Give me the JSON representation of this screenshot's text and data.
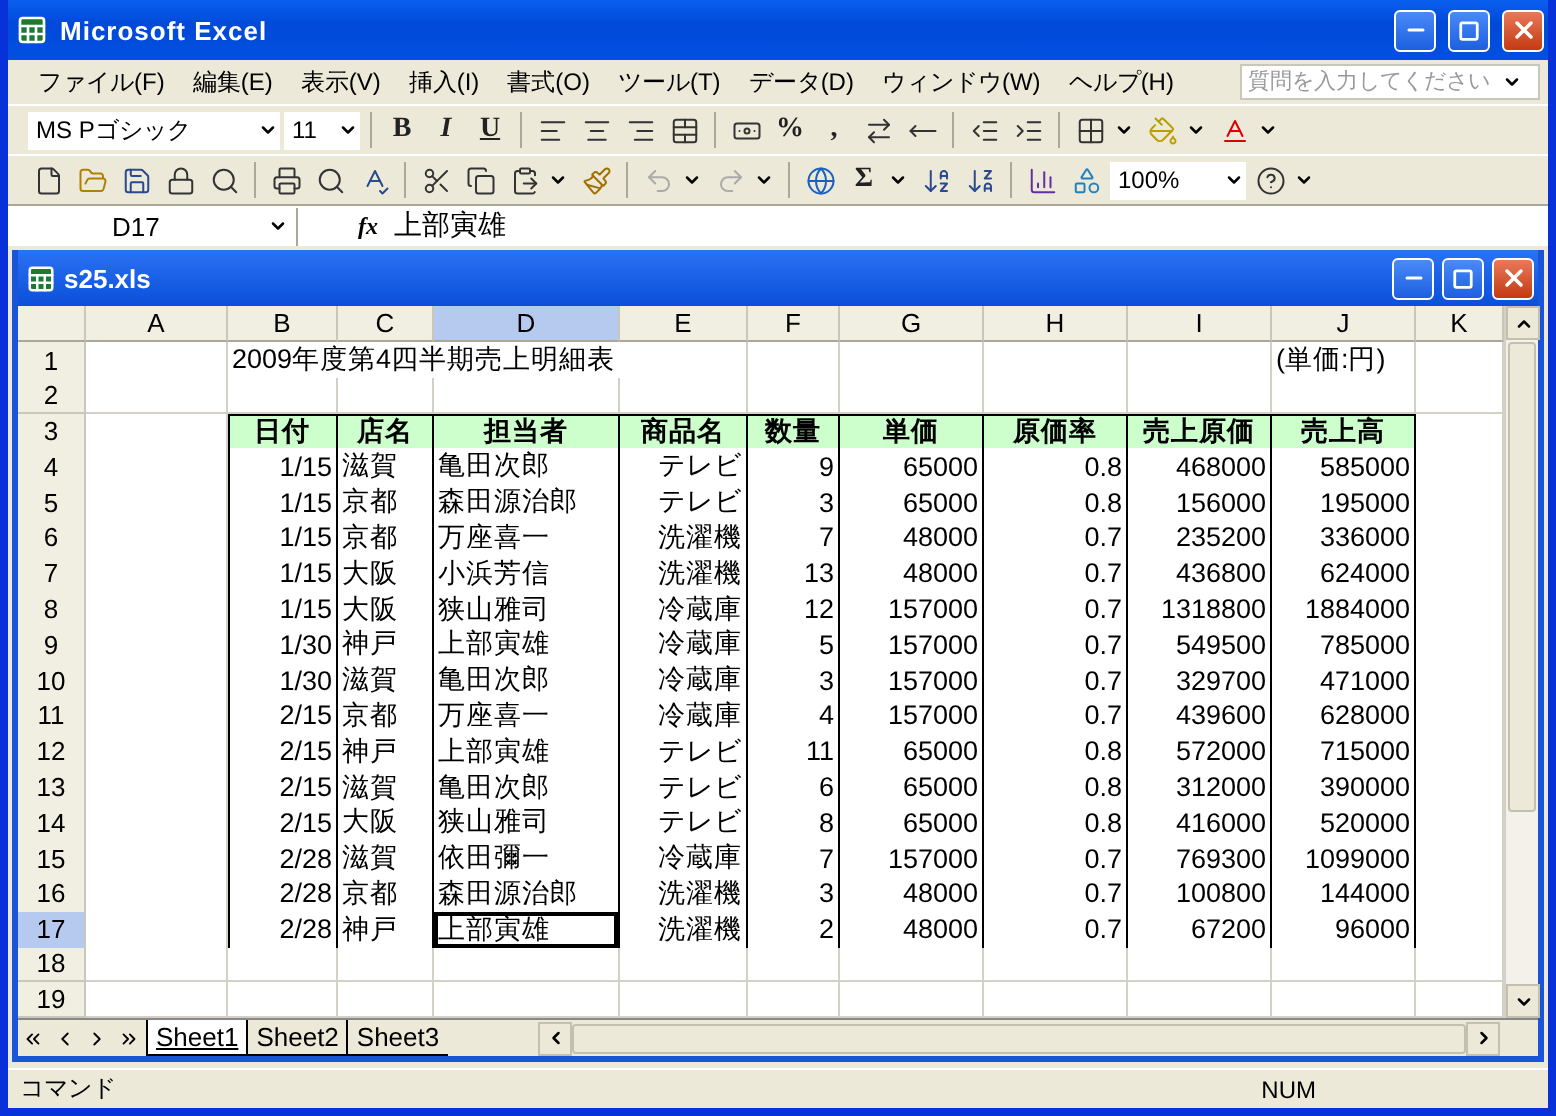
{
  "window": {
    "title": "Microsoft Excel"
  },
  "menu": [
    "ファイル(F)",
    "編集(E)",
    "表示(V)",
    "挿入(I)",
    "書式(O)",
    "ツール(T)",
    "データ(D)",
    "ウィンドウ(W)",
    "ヘルプ(H)"
  ],
  "help_search": {
    "placeholder": "質問を入力してください"
  },
  "formatting_toolbar": {
    "font": "MS Pゴシック",
    "size": "11",
    "style_buttons": [
      "B",
      "I",
      "U"
    ],
    "percent": "%",
    "comma": ","
  },
  "standard_toolbar": {
    "sum": "Σ",
    "zoom": "100%"
  },
  "formula_bar": {
    "name_box": "D17",
    "fx": "fx",
    "formula": "上部寅雄"
  },
  "workbook": {
    "title": "s25.xls",
    "columns": [
      {
        "label": "A",
        "selected": false
      },
      {
        "label": "B",
        "selected": false
      },
      {
        "label": "C",
        "selected": false
      },
      {
        "label": "D",
        "selected": true
      },
      {
        "label": "E",
        "selected": false
      },
      {
        "label": "F",
        "selected": false
      },
      {
        "label": "G",
        "selected": false
      },
      {
        "label": "H",
        "selected": false
      },
      {
        "label": "I",
        "selected": false
      },
      {
        "label": "J",
        "selected": false
      },
      {
        "label": "K",
        "selected": false
      }
    ],
    "rows": [
      {
        "number": "1",
        "selected": false,
        "kind": "title",
        "title": "2009年度第4四半期売上明細表",
        "unit": "(単価:円)"
      },
      {
        "number": "2",
        "selected": false,
        "kind": "empty"
      },
      {
        "number": "3",
        "selected": false,
        "kind": "header",
        "cells": [
          "日付",
          "店名",
          "担当者",
          "商品名",
          "数量",
          "単価",
          "原価率",
          "売上原価",
          "売上高"
        ]
      },
      {
        "number": "4",
        "selected": false,
        "kind": "data",
        "cells": [
          "1/15",
          "滋賀",
          "亀田次郎",
          "テレビ",
          "9",
          "65000",
          "0.8",
          "468000",
          "585000"
        ]
      },
      {
        "number": "5",
        "selected": false,
        "kind": "data",
        "cells": [
          "1/15",
          "京都",
          "森田源治郎",
          "テレビ",
          "3",
          "65000",
          "0.8",
          "156000",
          "195000"
        ]
      },
      {
        "number": "6",
        "selected": false,
        "kind": "data",
        "cells": [
          "1/15",
          "京都",
          "万座喜一",
          "洗濯機",
          "7",
          "48000",
          "0.7",
          "235200",
          "336000"
        ]
      },
      {
        "number": "7",
        "selected": false,
        "kind": "data",
        "cells": [
          "1/15",
          "大阪",
          "小浜芳信",
          "洗濯機",
          "13",
          "48000",
          "0.7",
          "436800",
          "624000"
        ]
      },
      {
        "number": "8",
        "selected": false,
        "kind": "data",
        "cells": [
          "1/15",
          "大阪",
          "狭山雅司",
          "冷蔵庫",
          "12",
          "157000",
          "0.7",
          "1318800",
          "1884000"
        ]
      },
      {
        "number": "9",
        "selected": false,
        "kind": "data",
        "cells": [
          "1/30",
          "神戸",
          "上部寅雄",
          "冷蔵庫",
          "5",
          "157000",
          "0.7",
          "549500",
          "785000"
        ]
      },
      {
        "number": "10",
        "selected": false,
        "kind": "data",
        "cells": [
          "1/30",
          "滋賀",
          "亀田次郎",
          "冷蔵庫",
          "3",
          "157000",
          "0.7",
          "329700",
          "471000"
        ]
      },
      {
        "number": "11",
        "selected": false,
        "kind": "data",
        "cells": [
          "2/15",
          "京都",
          "万座喜一",
          "冷蔵庫",
          "4",
          "157000",
          "0.7",
          "439600",
          "628000"
        ]
      },
      {
        "number": "12",
        "selected": false,
        "kind": "data",
        "cells": [
          "2/15",
          "神戸",
          "上部寅雄",
          "テレビ",
          "11",
          "65000",
          "0.8",
          "572000",
          "715000"
        ]
      },
      {
        "number": "13",
        "selected": false,
        "kind": "data",
        "cells": [
          "2/15",
          "滋賀",
          "亀田次郎",
          "テレビ",
          "6",
          "65000",
          "0.8",
          "312000",
          "390000"
        ]
      },
      {
        "number": "14",
        "selected": false,
        "kind": "data",
        "cells": [
          "2/15",
          "大阪",
          "狭山雅司",
          "テレビ",
          "8",
          "65000",
          "0.8",
          "416000",
          "520000"
        ]
      },
      {
        "number": "15",
        "selected": false,
        "kind": "data",
        "cells": [
          "2/28",
          "滋賀",
          "依田彌一",
          "冷蔵庫",
          "7",
          "157000",
          "0.7",
          "769300",
          "1099000"
        ]
      },
      {
        "number": "16",
        "selected": false,
        "kind": "data",
        "cells": [
          "2/28",
          "京都",
          "森田源治郎",
          "洗濯機",
          "3",
          "48000",
          "0.7",
          "100800",
          "144000"
        ]
      },
      {
        "number": "17",
        "selected": true,
        "kind": "data",
        "cells": [
          "2/28",
          "神戸",
          "上部寅雄",
          "洗濯機",
          "2",
          "48000",
          "0.7",
          "67200",
          "96000"
        ]
      },
      {
        "number": "18",
        "selected": false,
        "kind": "empty"
      },
      {
        "number": "19",
        "selected": false,
        "kind": "empty"
      }
    ],
    "sheet_tabs": [
      {
        "label": "Sheet1",
        "selected": true
      },
      {
        "label": "Sheet2",
        "selected": false
      },
      {
        "label": "Sheet3",
        "selected": false
      }
    ]
  },
  "status_bar": {
    "mode": "コマンド",
    "num": "NUM"
  }
}
